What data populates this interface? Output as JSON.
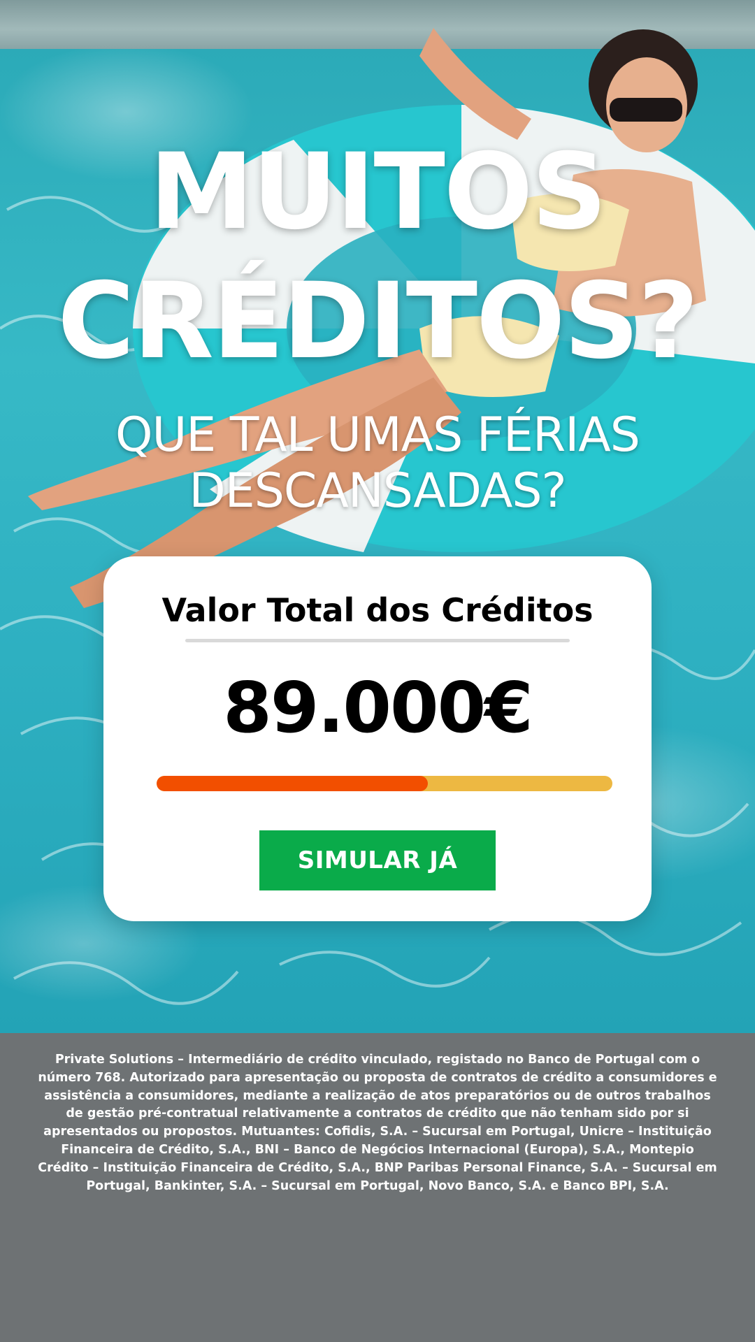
{
  "hero": {
    "headline_line1": "MUITOS",
    "headline_line2": "CRÉDITOS?",
    "subline_line1": "QUE TAL UMAS FÉRIAS",
    "subline_line2": "DESCANSADAS?"
  },
  "card": {
    "title": "Valor Total dos Créditos",
    "amount": "89.000€",
    "progress_fraction": 0.595,
    "cta_label": "SIMULAR JÁ"
  },
  "footer": {
    "disclaimer": "Private Solutions – Intermediário de crédito vinculado, registado no Banco de Portugal com o número 768. Autorizado para apresentação ou proposta de contratos de crédito a consumidores e assistência a consumidores, mediante a realização de atos preparatórios ou de outros trabalhos de gestão pré-contratual relativamente a contratos de crédito que não tenham sido por si apresentados ou propostos. Mutuantes: Cofidis, S.A. – Sucursal em Portugal, Unicre – Instituição Financeira de Crédito, S.A., BNI – Banco de Negócios Internacional (Europa), S.A., Montepio Crédito – Instituição Financeira de Crédito, S.A., BNP Paribas Personal Finance, S.A. – Sucursal em Portugal, Bankinter, S.A. – Sucursal em Portugal, Novo Banco, S.A. e Banco BPI, S.A."
  },
  "colors": {
    "progress_fill": "#f24f00",
    "progress_track": "#edb842",
    "cta_background": "#0aab4a",
    "footer_background": "#6e7274",
    "pool_water": "#2fb1c2"
  },
  "images": {
    "hero_background": "pool-float-photo"
  }
}
